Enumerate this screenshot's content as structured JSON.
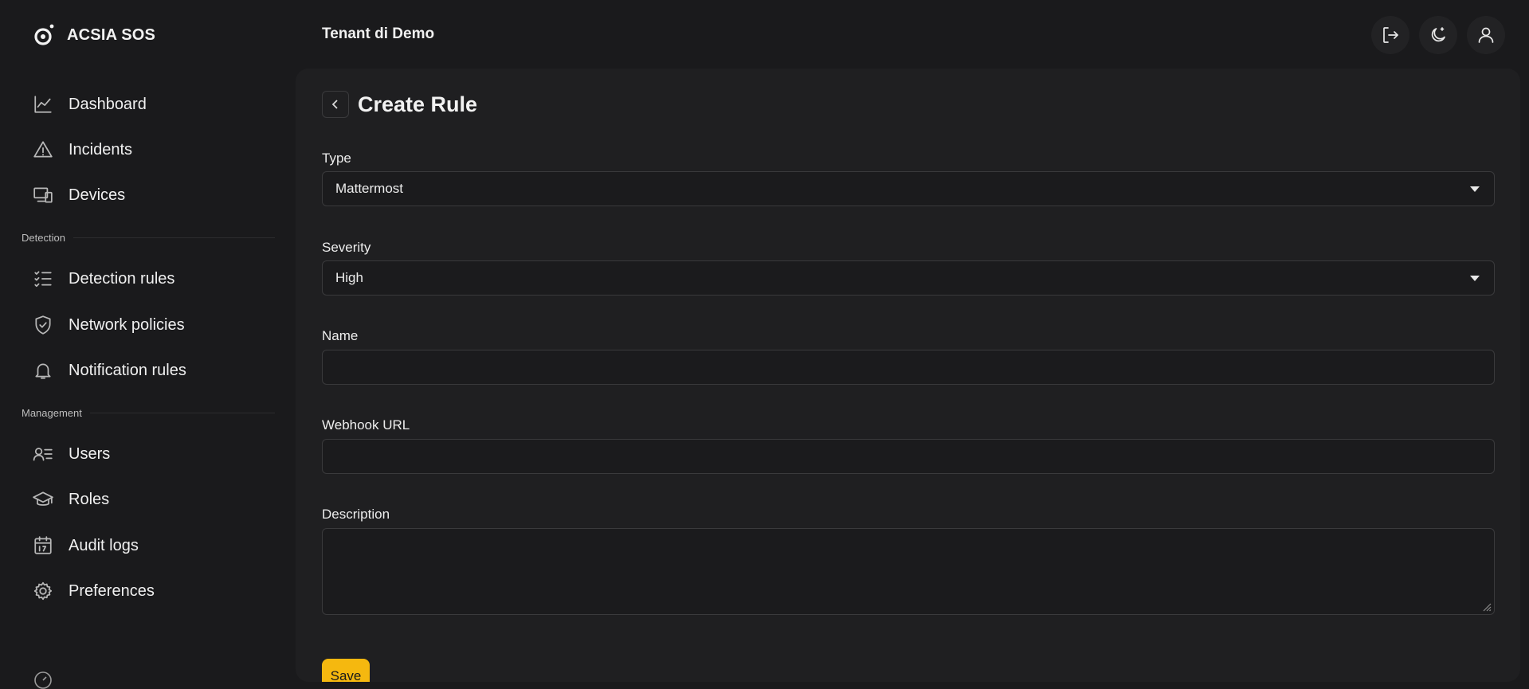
{
  "brand": {
    "name": "ACSIA SOS",
    "logo_icon": "acsia-logo-icon"
  },
  "header": {
    "tenant": "Tenant di Demo",
    "buttons": [
      {
        "name": "logout-button",
        "icon": "logout-icon"
      },
      {
        "name": "theme-toggle-button",
        "icon": "moon-icon"
      },
      {
        "name": "user-profile-button",
        "icon": "user-icon"
      }
    ]
  },
  "sidebar": {
    "main_items": [
      {
        "label": "Dashboard",
        "icon": "chart-line-icon"
      },
      {
        "label": "Incidents",
        "icon": "warning-triangle-icon"
      },
      {
        "label": "Devices",
        "icon": "devices-icon"
      }
    ],
    "detection_section": "Detection",
    "detection_items": [
      {
        "label": "Detection rules",
        "icon": "checklist-icon"
      },
      {
        "label": "Network policies",
        "icon": "shield-check-icon"
      },
      {
        "label": "Notification rules",
        "icon": "bell-icon"
      }
    ],
    "management_section": "Management",
    "management_items": [
      {
        "label": "Users",
        "icon": "users-list-icon"
      },
      {
        "label": "Roles",
        "icon": "graduation-cap-icon"
      },
      {
        "label": "Audit logs",
        "icon": "calendar-icon"
      },
      {
        "label": "Preferences",
        "icon": "gear-icon"
      }
    ]
  },
  "form": {
    "title": "Create Rule",
    "type": {
      "label": "Type",
      "value": "Mattermost"
    },
    "severity": {
      "label": "Severity",
      "value": "High"
    },
    "name": {
      "label": "Name",
      "value": "",
      "placeholder": ""
    },
    "webhook": {
      "label": "Webhook URL",
      "value": "",
      "placeholder": ""
    },
    "description": {
      "label": "Description",
      "value": ""
    },
    "save_label": "Save"
  },
  "colors": {
    "background": "#1a1a1c",
    "panel": "#1f1f21",
    "accent": "#f5b80f",
    "border": "#3a3a3c"
  }
}
